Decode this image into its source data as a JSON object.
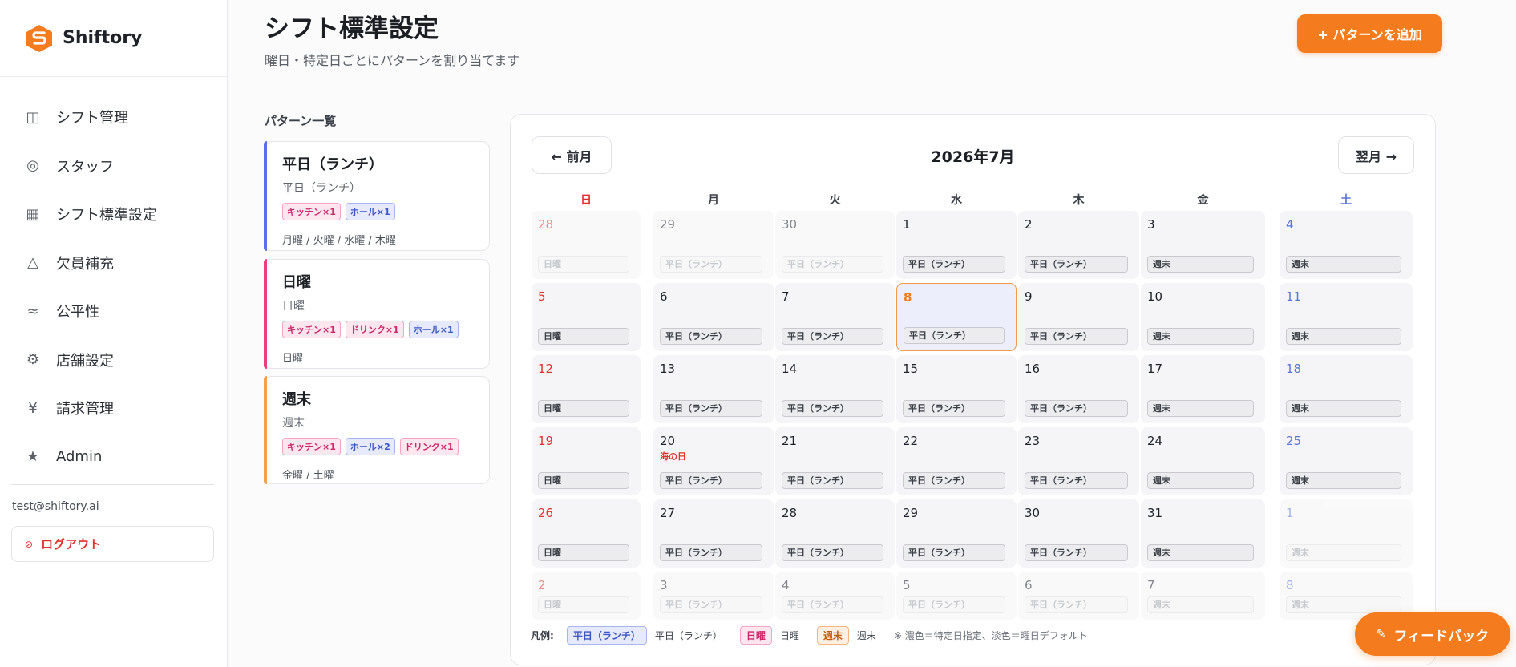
{
  "app": {
    "brand": "Shiftory",
    "brand_color": "#f57c1e"
  },
  "sidebar": {
    "items": [
      {
        "label": "シフト管理",
        "icon": "columns-icon"
      },
      {
        "label": "スタッフ",
        "icon": "target-icon"
      },
      {
        "label": "シフト標準設定",
        "icon": "grid-icon"
      },
      {
        "label": "欠員補充",
        "icon": "triangle-icon"
      },
      {
        "label": "公平性",
        "icon": "approx-icon"
      },
      {
        "label": "店舗設定",
        "icon": "gear-icon"
      },
      {
        "label": "請求管理",
        "icon": "yen-icon"
      },
      {
        "label": "Admin",
        "icon": "star-icon"
      }
    ],
    "user_email": "test@shiftory.ai",
    "logout_label": "ログアウト"
  },
  "header": {
    "title": "シフト標準設定",
    "subtitle": "曜日・特定日ごとにパターンを割り当てます",
    "add_button": "+ パターンを追加"
  },
  "patterns": {
    "heading": "パターン一覧",
    "items": [
      {
        "name": "平日（ランチ）",
        "sub": "平日（ランチ）",
        "accent": "#5b6cf0",
        "tags": [
          {
            "label": "キッチン×1",
            "color": "pink"
          },
          {
            "label": "ホール×1",
            "color": "blue"
          }
        ],
        "days": "月曜 / 火曜 / 水曜 / 木曜"
      },
      {
        "name": "日曜",
        "sub": "日曜",
        "accent": "#ec3d7f",
        "tags": [
          {
            "label": "キッチン×1",
            "color": "pink"
          },
          {
            "label": "ドリンク×1",
            "color": "pink"
          },
          {
            "label": "ホール×1",
            "color": "blue"
          }
        ],
        "days": "日曜"
      },
      {
        "name": "週末",
        "sub": "週末",
        "accent": "#f5a04a",
        "tags": [
          {
            "label": "キッチン×1",
            "color": "pink"
          },
          {
            "label": "ホール×2",
            "color": "blue"
          },
          {
            "label": "ドリンク×1",
            "color": "pink"
          }
        ],
        "days": "金曜 / 土曜"
      }
    ]
  },
  "calendar": {
    "prev_label": "← 前月",
    "next_label": "翌月 →",
    "month": "2026年7月",
    "weekdays": [
      "日",
      "月",
      "火",
      "水",
      "木",
      "金",
      "土"
    ],
    "weeks": [
      [
        {
          "d": "28",
          "b": "日曜",
          "f": true
        },
        {
          "d": "29",
          "b": "平日（ランチ）",
          "f": true
        },
        {
          "d": "30",
          "b": "平日（ランチ）",
          "f": true
        },
        {
          "d": "1",
          "b": "平日（ランチ）"
        },
        {
          "d": "2",
          "b": "平日（ランチ）"
        },
        {
          "d": "3",
          "b": "週末"
        },
        {
          "d": "4",
          "b": "週末"
        }
      ],
      [
        {
          "d": "5",
          "b": "日曜"
        },
        {
          "d": "6",
          "b": "平日（ランチ）"
        },
        {
          "d": "7",
          "b": "平日（ランチ）"
        },
        {
          "d": "8",
          "b": "平日（ランチ）",
          "today": true
        },
        {
          "d": "9",
          "b": "平日（ランチ）"
        },
        {
          "d": "10",
          "b": "週末"
        },
        {
          "d": "11",
          "b": "週末"
        }
      ],
      [
        {
          "d": "12",
          "b": "日曜"
        },
        {
          "d": "13",
          "b": "平日（ランチ）"
        },
        {
          "d": "14",
          "b": "平日（ランチ）"
        },
        {
          "d": "15",
          "b": "平日（ランチ）"
        },
        {
          "d": "16",
          "b": "平日（ランチ）"
        },
        {
          "d": "17",
          "b": "週末"
        },
        {
          "d": "18",
          "b": "週末"
        }
      ],
      [
        {
          "d": "19",
          "b": "日曜"
        },
        {
          "d": "20",
          "b": "平日（ランチ）",
          "holiday": "海の日"
        },
        {
          "d": "21",
          "b": "平日（ランチ）"
        },
        {
          "d": "22",
          "b": "平日（ランチ）"
        },
        {
          "d": "23",
          "b": "平日（ランチ）"
        },
        {
          "d": "24",
          "b": "週末"
        },
        {
          "d": "25",
          "b": "週末"
        }
      ],
      [
        {
          "d": "26",
          "b": "日曜"
        },
        {
          "d": "27",
          "b": "平日（ランチ）"
        },
        {
          "d": "28",
          "b": "平日（ランチ）"
        },
        {
          "d": "29",
          "b": "平日（ランチ）"
        },
        {
          "d": "30",
          "b": "平日（ランチ）"
        },
        {
          "d": "31",
          "b": "週末"
        },
        {
          "d": "1",
          "b": "週末",
          "f": true
        }
      ],
      [
        {
          "d": "2",
          "b": "日曜",
          "f": true
        },
        {
          "d": "3",
          "b": "平日（ランチ）",
          "f": true
        },
        {
          "d": "4",
          "b": "平日（ランチ）",
          "f": true
        },
        {
          "d": "5",
          "b": "平日（ランチ）",
          "f": true
        },
        {
          "d": "6",
          "b": "平日（ランチ）",
          "f": true
        },
        {
          "d": "7",
          "b": "週末",
          "f": true
        },
        {
          "d": "8",
          "b": "週末",
          "f": true
        }
      ]
    ]
  },
  "legend": {
    "label": "凡例:",
    "items": [
      {
        "chip": "平日（ランチ）",
        "text": "平日（ランチ）",
        "color": "blue"
      },
      {
        "chip": "日曜",
        "text": "日曜",
        "color": "pink"
      },
      {
        "chip": "週末",
        "text": "週末",
        "color": "orange"
      }
    ],
    "note": "※ 濃色＝特定日指定、淡色＝曜日デフォルト"
  },
  "feedback_label": "フィードバック"
}
